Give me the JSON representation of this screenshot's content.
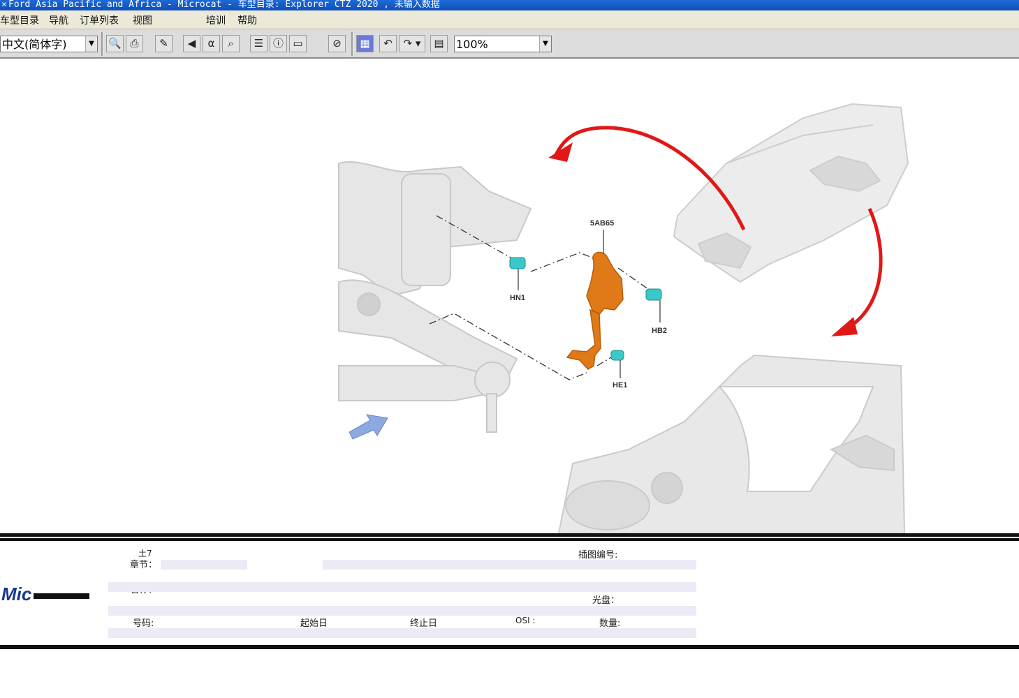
{
  "window": {
    "title": "Ford Asia Pacific and Africa - Microcat - 车型目录: Explorer CTZ 2020 , 未输入数据"
  },
  "menu": {
    "items": [
      "车型目录",
      "导航",
      "订单列表",
      "视图",
      "培训",
      "帮助"
    ]
  },
  "toolbar": {
    "language": "中文(简体字)",
    "zoom": "100%",
    "icons": [
      "print-preview-icon",
      "print-icon",
      "tools-icon",
      "bookmark-icon",
      "alpha-icon",
      "search-icon",
      "list-icon",
      "info-icon",
      "monitor-icon",
      "stop-icon",
      "color-icon",
      "undo-icon",
      "redo-icon",
      "note-icon"
    ]
  },
  "diagram": {
    "callouts": {
      "main": "5AB65",
      "hn1": "HN1",
      "hb2": "HB2",
      "he1": "HE1"
    },
    "colors": {
      "part": "#e07a18",
      "fastener": "#3cc8c8",
      "arrow": "#e01818",
      "direction_arrow": "#8ea8e0"
    }
  },
  "info": {
    "section_label": "章节：",
    "section_prefix": "土7",
    "illustration_label": "插图编号:",
    "name_label": "名称：",
    "disc_label": "光盘：",
    "number_label": "号码:",
    "start_label": "起始日",
    "end_label": "终止日",
    "osi_label": "OSI :",
    "quantity_label": "数量:",
    "logo_text": "Mic"
  }
}
